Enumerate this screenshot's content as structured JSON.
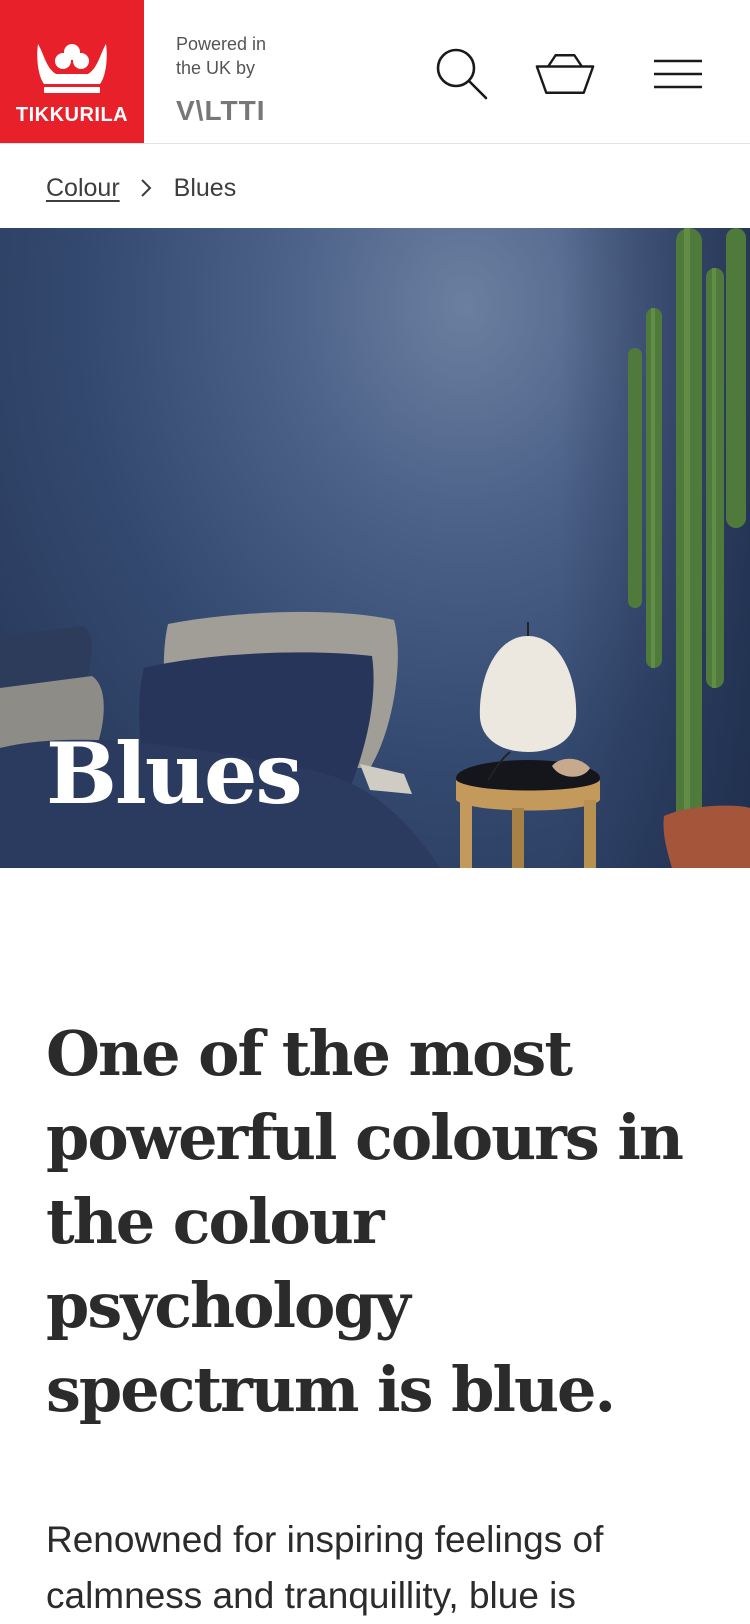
{
  "header": {
    "logo_text": "TIKKURILA",
    "powered_by": "Powered in the UK by",
    "partner": "V\\LTTI",
    "brand_color": "#e8202a",
    "icons": [
      "search-icon",
      "basket-icon",
      "hamburger-menu-icon"
    ]
  },
  "breadcrumb": {
    "parent": "Colour",
    "current": "Blues"
  },
  "hero": {
    "title": "Blues"
  },
  "content": {
    "headline": "One of the most powerful colours in the colour psychology spectrum is blue.",
    "body": "Renowned for inspiring feelings of calmness and tranquillity, blue is"
  }
}
